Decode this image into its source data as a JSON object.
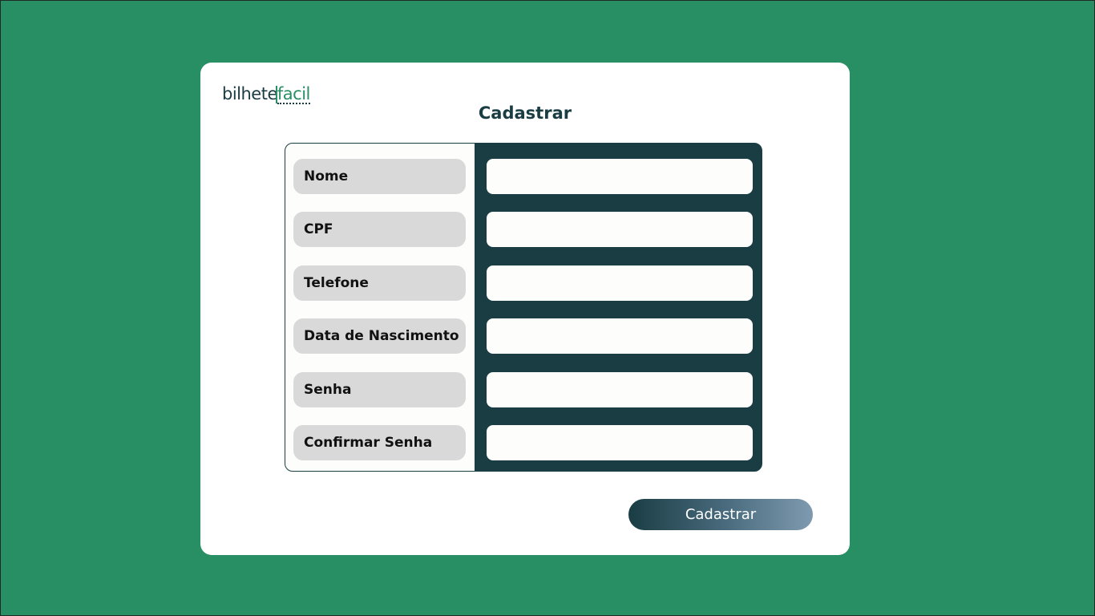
{
  "brand": {
    "logo_primary": "bilhete",
    "logo_accent": "facil",
    "primary_color": "#1a3d44",
    "accent_color": "#278f63",
    "background_color": "#278f63"
  },
  "page": {
    "title": "Cadastrar"
  },
  "form": {
    "fields": [
      {
        "label": "Nome",
        "value": "",
        "placeholder": ""
      },
      {
        "label": "CPF",
        "value": "",
        "placeholder": ""
      },
      {
        "label": "Telefone",
        "value": "",
        "placeholder": ""
      },
      {
        "label": "Data de Nascimento",
        "value": "",
        "placeholder": ""
      },
      {
        "label": "Senha",
        "value": "",
        "placeholder": ""
      },
      {
        "label": "Confirmar Senha",
        "value": "",
        "placeholder": ""
      }
    ],
    "submit_label": "Cadastrar"
  }
}
